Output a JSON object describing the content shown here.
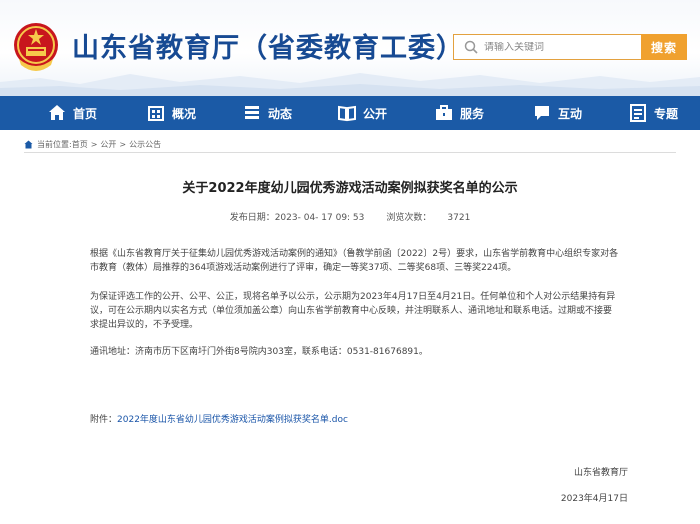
{
  "header": {
    "site_title": "山东省教育厅（省委教育工委）",
    "search_placeholder": "请输入关键词",
    "search_button": "搜索"
  },
  "nav": {
    "items": [
      {
        "label": "首页",
        "icon": "home-icon"
      },
      {
        "label": "概况",
        "icon": "building-icon"
      },
      {
        "label": "动态",
        "icon": "stack-icon"
      },
      {
        "label": "公开",
        "icon": "book-icon"
      },
      {
        "label": "服务",
        "icon": "briefcase-icon"
      },
      {
        "label": "互动",
        "icon": "chat-icon"
      },
      {
        "label": "专题",
        "icon": "list-icon"
      }
    ]
  },
  "breadcrumb": {
    "prefix": "当前位置:",
    "items": [
      "首页",
      "公开",
      "公示公告"
    ],
    "separator": ">"
  },
  "article": {
    "title": "关于2022年度幼儿园优秀游戏活动案例拟获奖名单的公示",
    "publish_label": "发布日期：",
    "publish_date": "2023- 04- 17 09: 53",
    "views_label": "浏览次数：",
    "views": "3721",
    "paragraphs": [
      "根据《山东省教育厅关于征集幼儿园优秀游戏活动案例的通知》（鲁教学前函〔2022〕2号）要求，山东省学前教育中心组织专家对各市教育（教体）局推荐的364项游戏活动案例进行了评审，确定一等奖37项、二等奖68项、三等奖224项。",
      "为保证评选工作的公开、公平、公正，现将名单予以公示，公示期为2023年4月17日至4月21日。任何单位和个人对公示结果持有异议，可在公示期内以实名方式（单位须加盖公章）向山东省学前教育中心反映，并注明联系人、通讯地址和联系电话。过期或不接要求提出异议的，不予受理。",
      "通讯地址：济南市历下区南圩门外街8号院内303室，联系电话：0531-81676891。"
    ],
    "attachment_label": "附件：",
    "attachment_link": "2022年度山东省幼儿园优秀游戏活动案例拟获奖名单.doc",
    "signature_org": "山东省教育厅",
    "signature_date": "2023年4月17日"
  },
  "colors": {
    "nav_bg": "#1b5aa6",
    "title_blue": "#174a93",
    "search_orange": "#f0a12f",
    "link_blue": "#1a55a8"
  }
}
